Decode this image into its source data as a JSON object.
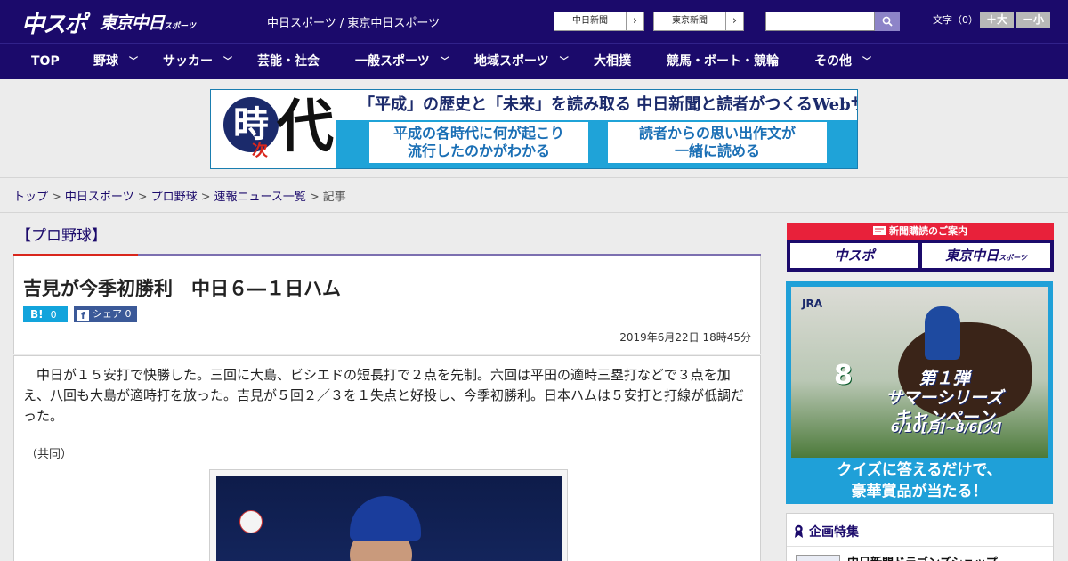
{
  "header": {
    "logo_chuspo": "中スポ",
    "logo_tokyo": "東京中日",
    "logo_tokyo_sub": "スポーツ",
    "site_link": "中日スポーツ / 東京中日スポーツ",
    "paper_links": [
      {
        "label": "中日新聞",
        "arrow": "›"
      },
      {
        "label": "東京新聞",
        "arrow": "›"
      }
    ],
    "search": {
      "value": "",
      "placeholder": ""
    },
    "font_size": {
      "label": "文字（0）",
      "increase": "＋大",
      "decrease": "－小"
    }
  },
  "nav": {
    "items": [
      {
        "label": "TOP",
        "chevron": ""
      },
      {
        "label": "野球",
        "chevron": "﹀"
      },
      {
        "label": "サッカー",
        "chevron": "﹀"
      },
      {
        "label": "芸能・社会",
        "chevron": ""
      },
      {
        "label": "一般スポーツ",
        "chevron": "﹀"
      },
      {
        "label": "地域スポーツ",
        "chevron": "﹀"
      },
      {
        "label": "大相撲",
        "chevron": ""
      },
      {
        "label": "競馬・ボート・競輪",
        "chevron": ""
      },
      {
        "label": "その他",
        "chevron": "﹀"
      }
    ]
  },
  "banner": {
    "ji": "時",
    "tsugi": "次",
    "dai": "代",
    "headline": "「平成」の歴史と「未来」を読み取る  中日新聞と読者がつくるWebサイト",
    "box_left": [
      "平成の各時代に何が起こり",
      "流行したのかがわかる"
    ],
    "box_right": [
      "読者からの思い出作文が",
      "一緒に読める"
    ]
  },
  "breadcrumb": {
    "items": [
      "トップ",
      "中日スポーツ",
      "プロ野球",
      "速報ニュース一覧"
    ],
    "current": "記事",
    "separator": ">"
  },
  "article": {
    "section": "【プロ野球】",
    "headline": "吉見が今季初勝利　中日６―１日ハム",
    "hatena_label": "B!",
    "hatena_count": "0",
    "fb_icon": "f",
    "share_label": "シェア",
    "share_count": "0",
    "date": "2019年6月22日 18時45分",
    "body": "中日が１５安打で快勝した。三回に大島、ビシエドの短長打で２点を先制。六回は平田の適時三塁打などで３点を加え、八回も大島が適時打を放った。吉見が５回２／３を１失点と好投し、今季初勝利。日本ハムは５安打と打線が低調だった。",
    "credit": "（共同）"
  },
  "sidebar": {
    "subscribe_head": "新聞購読のご案内",
    "subscribe_logo1": "中スポ",
    "subscribe_logo2": "東京中日",
    "subscribe_logo2_sub": "スポーツ",
    "jra_logo": "JRA",
    "jra_number": "8",
    "jra_title": [
      "第１弾",
      "サマーシリーズ",
      "キャンペーン"
    ],
    "jra_dates": "6/10[月]~8/6[火]",
    "jra_copy": [
      "クイズに答えるだけで、",
      "豪華賞品が当たる！"
    ],
    "feature_head": "企画特集",
    "feature_link": "中日新聞ドラゴンズショップ"
  },
  "colors": {
    "brand_navy": "#1b0a6b",
    "accent_red": "#d9261c",
    "hatena_blue": "#12a4dc",
    "facebook_blue": "#3b5998",
    "jra_blue": "#1fa0d8"
  },
  "icons": {
    "search": "magnifier-icon",
    "hatena": "hatena-bookmark-icon",
    "facebook": "facebook-icon",
    "newspaper": "newspaper-icon",
    "ribbon": "ribbon-icon"
  }
}
